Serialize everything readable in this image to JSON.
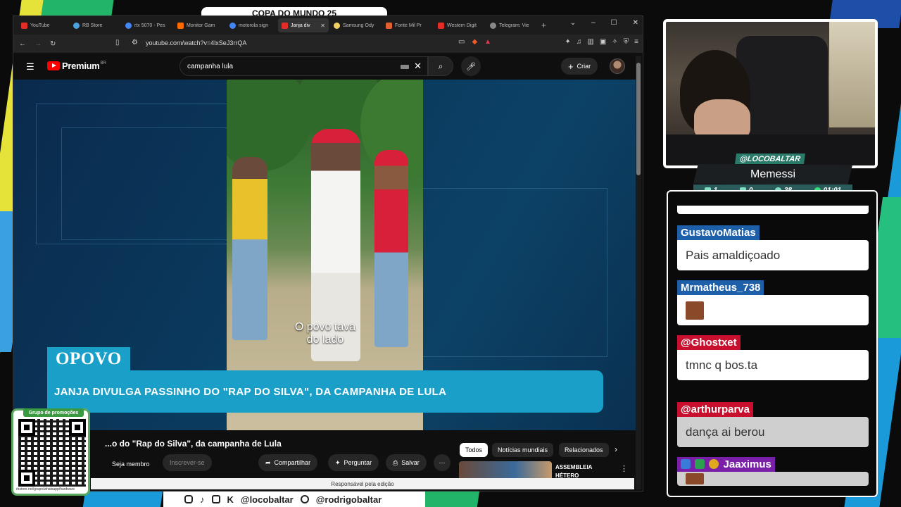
{
  "overlay": {
    "top_pill": "COPA DO MUNDO 25",
    "webcam": {
      "handle": "@LOCOBALTAR",
      "nickname": "Memessi",
      "stats": [
        {
          "icon": "chat-icon",
          "value": "1"
        },
        {
          "icon": "video-icon",
          "value": "0"
        },
        {
          "icon": "viewer-icon",
          "value": "38"
        },
        {
          "icon": "clock-icon",
          "value": "01:01"
        }
      ]
    },
    "qr": {
      "title": "Grupo de promoções",
      "url": "rbstore.net/grupo/whatsapp/hardware"
    },
    "social": {
      "handle1": "@locobaltar",
      "handle2": "@rodrigobaltar"
    }
  },
  "browser": {
    "tabs": [
      {
        "label": "YouTube",
        "color": "#e52d27"
      },
      {
        "label": "RB Store",
        "color": "#4aa3df"
      },
      {
        "label": "rtx 5070 - Pes",
        "color": "#4285f4"
      },
      {
        "label": "Monitor Gam",
        "color": "#ff6a00"
      },
      {
        "label": "motorola sign",
        "color": "#4285f4"
      },
      {
        "label": "Janja div",
        "color": "#e52d27",
        "active": true
      },
      {
        "label": "Samsung Ody",
        "color": "#f0d060"
      },
      {
        "label": "Fonte Mil Pr",
        "color": "#e06030"
      },
      {
        "label": "Western Digit",
        "color": "#e52d27"
      },
      {
        "label": "Telegram: Vie",
        "color": "#888888"
      }
    ],
    "url": "youtube.com/watch?v=4lxSeJ3rrQA"
  },
  "youtube": {
    "brand": "Premium",
    "region": "BR",
    "search_query": "campanha lula",
    "create_label": "Criar",
    "video": {
      "caption_line1": "O povo tava",
      "caption_line2": "do lado",
      "outlet": "OPOVO",
      "headline": "JANJA DIVULGA PASSINHO DO \"RAP DO SILVA\", DA CAMPANHA DE LULA"
    },
    "title": "...o do \"Rap do Silva\", da campanha de Lula",
    "join_label": "Seja membro",
    "subscribe_label": "Inscrever-se",
    "share_label": "Compartilhar",
    "ask_label": "Perguntar",
    "save_label": "Salvar",
    "chips": [
      {
        "label": "Todos",
        "active": true
      },
      {
        "label": "Notícias mundiais"
      },
      {
        "label": "Relacionados"
      }
    ],
    "rec_title_line1": "ASSEMBLEIA",
    "rec_title_line2": "HÉTERO",
    "editor_note": "Responsável pela edição"
  },
  "chat": {
    "messages": [
      {
        "user": "GustavoMatias",
        "user_color": "#1d5fa8",
        "text": "Pais amaldiçoado"
      },
      {
        "user": "Mrmatheus_738",
        "user_color": "#1d5fa8",
        "emote": "meme-face-emote"
      },
      {
        "user": "@Ghostxet",
        "user_color": "#c8102e",
        "text": "tmnc q bos.ta"
      },
      {
        "user": "@arthurparva",
        "user_color": "#c8102e",
        "text": "dança ai berou"
      },
      {
        "user": "Jaaximus",
        "user_color": "#7a1fa8",
        "emote": "meme-face-emote"
      }
    ]
  }
}
